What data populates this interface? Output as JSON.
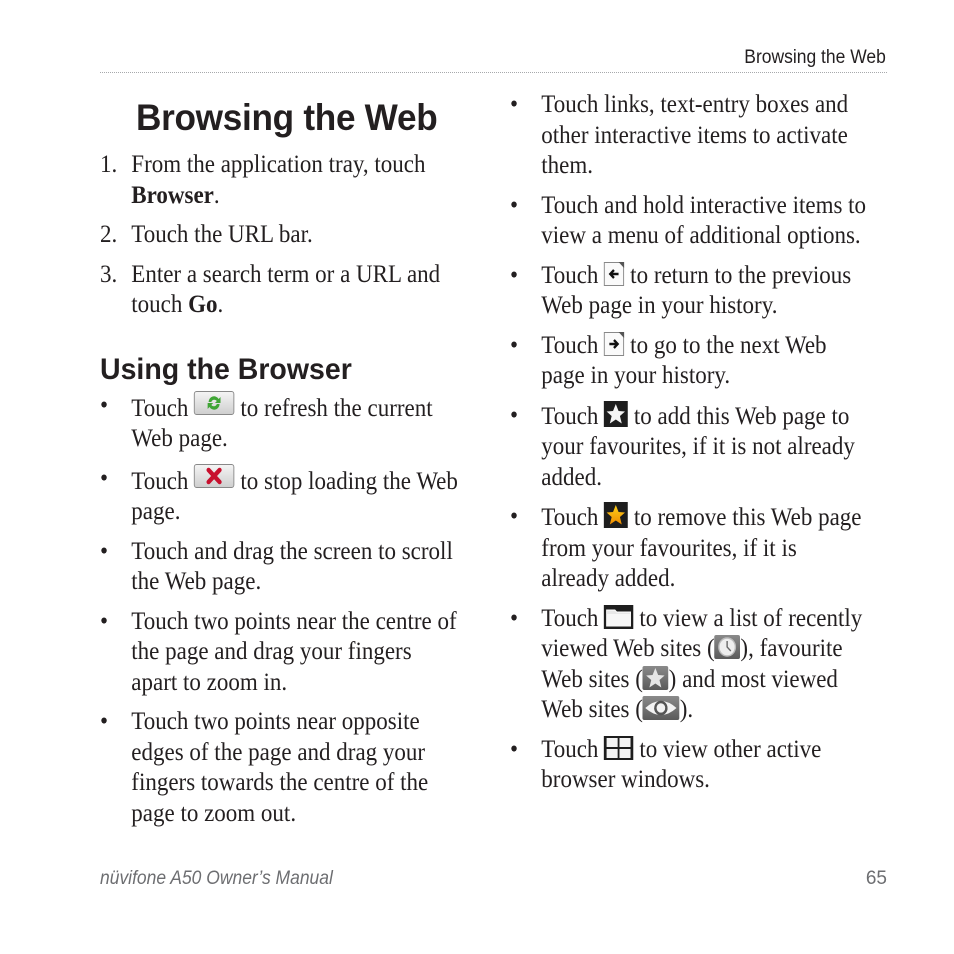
{
  "header": {
    "running_title": "Browsing the Web"
  },
  "left": {
    "title": "Browsing the Web",
    "steps": [
      {
        "num": "1.",
        "pre": "From the application tray, touch ",
        "bold": "Browser",
        "post": "."
      },
      {
        "num": "2.",
        "pre": "Touch the URL bar.",
        "bold": "",
        "post": ""
      },
      {
        "num": "3.",
        "pre": "Enter a search term or a URL and touch ",
        "bold": "Go",
        "post": "."
      }
    ],
    "subtitle": "Using the Browser",
    "bullets": [
      {
        "pre": "Touch ",
        "icon": "refresh-icon",
        "post": " to refresh the current Web page."
      },
      {
        "pre": "Touch ",
        "icon": "stop-icon",
        "post": " to stop loading the Web page."
      },
      {
        "pre": "Touch and drag the screen to scroll the Web page.",
        "icon": "",
        "post": ""
      },
      {
        "pre": "Touch two points near the centre of the page and drag your fingers apart to zoom in.",
        "icon": "",
        "post": ""
      },
      {
        "pre": "Touch two points near opposite edges of the page and drag your fingers towards the centre of the page to zoom out.",
        "icon": "",
        "post": ""
      }
    ]
  },
  "right": {
    "bullets": [
      {
        "pre": "Touch links, text-entry boxes and other interactive items to activate them."
      },
      {
        "pre": "Touch and hold interactive items to view a menu of additional options."
      },
      {
        "pre": "Touch ",
        "icon": "back-icon",
        "post": " to return to the previous Web page in your history."
      },
      {
        "pre": "Touch ",
        "icon": "forward-icon",
        "post": " to go to the next Web page in your history."
      },
      {
        "pre": "Touch ",
        "icon": "add-favourite-icon",
        "post": " to add this Web page to your favourites, if it is not already added."
      },
      {
        "pre": "Touch ",
        "icon": "remove-favourite-icon",
        "post": " to remove this Web page from your favourites, if it is already added."
      },
      {
        "pre": "Touch ",
        "icon": "folder-icon",
        "mid1": " to view a list of recently viewed Web sites (",
        "icon2": "clock-icon",
        "mid2": "), favourite Web sites (",
        "icon3": "star-icon",
        "mid3": ") and most viewed Web sites (",
        "icon4": "eye-icon",
        "post": ")."
      },
      {
        "pre": "Touch ",
        "icon": "windows-icon",
        "post": " to view other active browser windows."
      }
    ],
    "bullet_char": "•"
  },
  "footer": {
    "manual_title": "nüvifone A50 Owner’s Manual",
    "page_number": "65"
  }
}
